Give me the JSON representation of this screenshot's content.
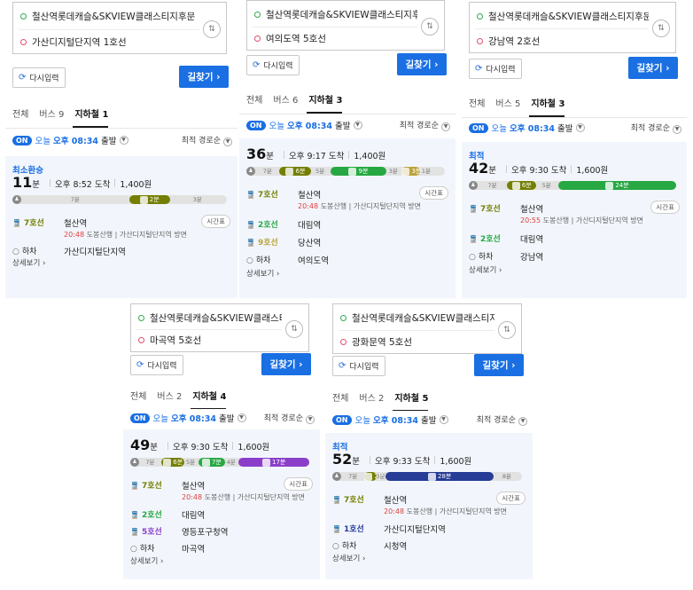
{
  "common": {
    "origin": "철산역롯데캐슬&SKVIEW클래스티지후문",
    "reset_label": "다시입력",
    "search_label": "길찾기",
    "tab_all": "전체",
    "on_badge": "ON",
    "today": "오늘",
    "depart_time": "오후 08:34",
    "depart_suffix": "출발",
    "sort_label": "최적 경로순",
    "minute_unit": "분",
    "exit_label": "하차",
    "details_label": "상세보기",
    "timetable_label": "시간표"
  },
  "panels": [
    {
      "destination": "가산디지털단지역 1호선",
      "tab_bus": "버스 9",
      "tab_subway": "지하철 1",
      "route_label": "최소환승",
      "minutes": "11",
      "arrival": "오후 8:52 도착",
      "fare": "1,400원",
      "segments": [
        {
          "kind": "walk",
          "label": "7분",
          "share": 0.52
        },
        {
          "kind": "ride",
          "label": "2분",
          "share": 0.2,
          "color": "#747f00"
        },
        {
          "kind": "walk",
          "label": "3분",
          "share": 0.28
        }
      ],
      "steps": [
        {
          "line": "7호선",
          "color": "#747f00",
          "station": "철산역",
          "time": "20:48",
          "direction": "도봉산행 | 가산디지털단지역 방면",
          "timetable": true
        },
        {
          "line": "하차",
          "color": "",
          "station": "가산디지털단지역",
          "exit": true
        }
      ]
    },
    {
      "destination": "여의도역 5호선",
      "tab_bus": "버스 6",
      "tab_subway": "지하철 3",
      "route_label": "",
      "minutes": "36",
      "arrival": "오후 9:17 도착",
      "fare": "1,400원",
      "segments": [
        {
          "kind": "walk",
          "label": "7분",
          "share": 0.12
        },
        {
          "kind": "ride",
          "label": "6분",
          "share": 0.17,
          "color": "#747f00"
        },
        {
          "kind": "walk",
          "label": "5분",
          "share": 0.1
        },
        {
          "kind": "ride",
          "label": "9분",
          "share": 0.3,
          "color": "#27a843"
        },
        {
          "kind": "walk",
          "label": "3분",
          "share": 0.08
        },
        {
          "kind": "ride",
          "label": "3분",
          "share": 0.1,
          "color": "#bda23a"
        },
        {
          "kind": "walk",
          "label": "1분",
          "share": 0.07
        }
      ],
      "steps": [
        {
          "line": "7호선",
          "color": "#747f00",
          "station": "철산역",
          "time": "20:48",
          "direction": "도봉산행 | 가산디지털단지역 방면",
          "timetable": true
        },
        {
          "line": "2호선",
          "color": "#27a843",
          "station": "대림역"
        },
        {
          "line": "9호선",
          "color": "#bda23a",
          "station": "당산역"
        },
        {
          "line": "하차",
          "color": "",
          "station": "여의도역",
          "exit": true
        }
      ]
    },
    {
      "destination": "강남역 2호선",
      "tab_bus": "버스 5",
      "tab_subway": "지하철 3",
      "route_label": "최적",
      "minutes": "42",
      "arrival": "오후 9:30 도착",
      "fare": "1,600원",
      "segments": [
        {
          "kind": "walk",
          "label": "7분",
          "share": 0.14
        },
        {
          "kind": "ride",
          "label": "6분",
          "share": 0.15,
          "color": "#747f00"
        },
        {
          "kind": "walk",
          "label": "5분",
          "share": 0.11
        },
        {
          "kind": "ride",
          "label": "24분",
          "share": 0.6,
          "color": "#27a843"
        }
      ],
      "steps": [
        {
          "line": "7호선",
          "color": "#747f00",
          "station": "철산역",
          "time": "20:55",
          "direction": "도봉산행 | 가산디지털단지역 방면",
          "timetable": true
        },
        {
          "line": "2호선",
          "color": "#27a843",
          "station": "대림역"
        },
        {
          "line": "하차",
          "color": "",
          "station": "강남역",
          "exit": true
        }
      ]
    },
    {
      "destination": "마곡역 5호선",
      "tab_bus": "버스 2",
      "tab_subway": "지하철 4",
      "route_label": "",
      "minutes": "49",
      "arrival": "오후 9:30 도착",
      "fare": "1,600원",
      "segments": [
        {
          "kind": "walk",
          "label": "7분",
          "share": 0.12
        },
        {
          "kind": "ride",
          "label": "6분",
          "share": 0.14,
          "color": "#747f00"
        },
        {
          "kind": "walk",
          "label": "5분",
          "share": 0.08
        },
        {
          "kind": "ride",
          "label": "7분",
          "share": 0.16,
          "color": "#27a843"
        },
        {
          "kind": "walk",
          "label": "4분",
          "share": 0.08
        },
        {
          "kind": "ride",
          "label": "17분",
          "share": 0.42,
          "color": "#8b3fc9"
        }
      ],
      "steps": [
        {
          "line": "7호선",
          "color": "#747f00",
          "station": "철산역",
          "time": "20:48",
          "direction": "도봉산행 | 가산디지털단지역 방면",
          "timetable": true
        },
        {
          "line": "2호선",
          "color": "#27a843",
          "station": "대림역"
        },
        {
          "line": "5호선",
          "color": "#8b3fc9",
          "station": "영등포구청역"
        },
        {
          "line": "하차",
          "color": "",
          "station": "마곡역",
          "exit": true
        }
      ]
    },
    {
      "destination": "광화문역 5호선",
      "tab_bus": "버스 2",
      "tab_subway": "지하철 5",
      "route_label": "최적",
      "minutes": "52",
      "arrival": "오후 9:33 도착",
      "fare": "1,600원",
      "segments": [
        {
          "kind": "walk",
          "label": "7분",
          "share": 0.12
        },
        {
          "kind": "ride",
          "label": "2분",
          "share": 0.07,
          "color": "#747f00"
        },
        {
          "kind": "walk",
          "label": "3분",
          "share": 0.05
        },
        {
          "kind": "ride",
          "label": "28분",
          "share": 0.6,
          "color": "#263c96"
        },
        {
          "kind": "walk",
          "label": "8분",
          "share": 0.16
        }
      ],
      "steps": [
        {
          "line": "7호선",
          "color": "#747f00",
          "station": "철산역",
          "time": "20:48",
          "direction": "도봉산행 | 가산디지털단지역 방면",
          "timetable": true
        },
        {
          "line": "1호선",
          "color": "#263c96",
          "station": "가산디지털단지역"
        },
        {
          "line": "하차",
          "color": "",
          "station": "시청역",
          "exit": true
        }
      ]
    }
  ]
}
